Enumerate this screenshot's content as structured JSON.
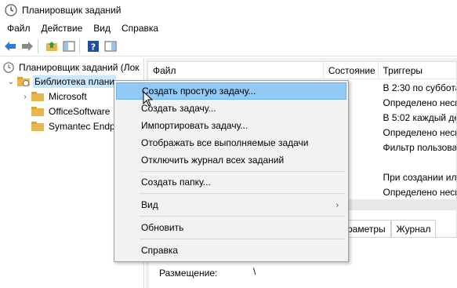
{
  "window": {
    "title": "Планировщик заданий"
  },
  "menubar": [
    "Файл",
    "Действие",
    "Вид",
    "Справка"
  ],
  "tree": {
    "root": "Планировщик заданий (Лок",
    "library": "Библиотека плани",
    "children": [
      "Microsoft",
      "OfficeSoftware",
      "Symantec Endp"
    ]
  },
  "grid": {
    "columns": [
      "Файл",
      "Состояние",
      "Триггеры"
    ],
    "rows": [
      {
        "status": "",
        "trigger": "В 2:30 по суббота"
      },
      {
        "status": "",
        "trigger": "Определено неско"
      },
      {
        "status": "",
        "trigger": "В 5:02 каждый ден"
      },
      {
        "status": "",
        "trigger": "Определено неско"
      },
      {
        "status": "",
        "trigger": "Фильтр пользоват"
      },
      {
        "status": "",
        "trigger": ""
      },
      {
        "status": "",
        "trigger": "При создании или"
      },
      {
        "status": "",
        "trigger": "Определено неско"
      }
    ]
  },
  "tabs": [
    "раметры",
    "Журнал"
  ],
  "details": {
    "location_label": "Размещение:",
    "location_value": "\\"
  },
  "context_menu": {
    "items": [
      {
        "label": "Создать простую задачу...",
        "highlighted": true
      },
      {
        "label": "Создать задачу..."
      },
      {
        "label": "Импортировать задачу..."
      },
      {
        "label": "Отображать все выполняемые задачи"
      },
      {
        "label": "Отключить журнал всех заданий"
      },
      {
        "label": "Создать папку..."
      },
      {
        "label": "Вид",
        "submenu": true
      },
      {
        "label": "Обновить"
      },
      {
        "label": "Справка"
      }
    ]
  },
  "colors": {
    "highlight": "#91c9f7",
    "selection": "#cce8ff",
    "folder": "#e8b64a",
    "accent": "#1f6fc4"
  }
}
